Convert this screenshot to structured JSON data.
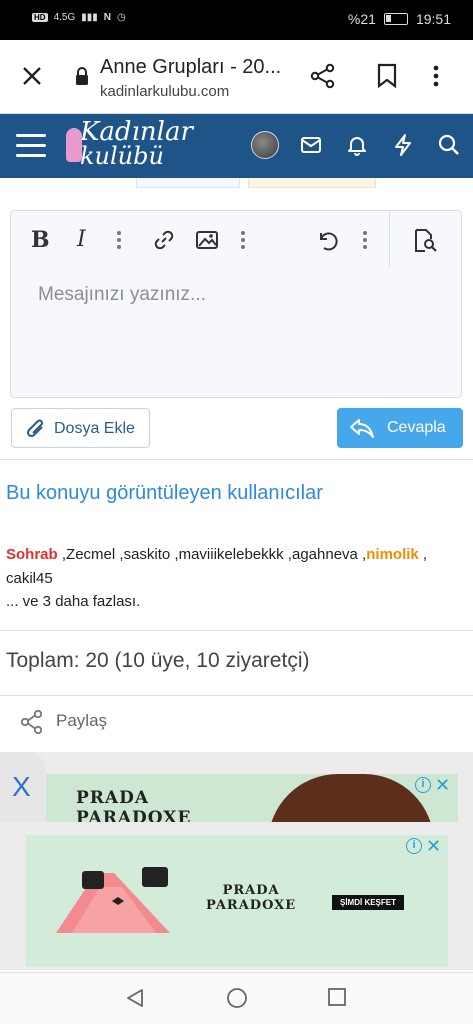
{
  "status_bar": {
    "network": "4.5G",
    "battery": "%21",
    "time": "19:51"
  },
  "browser": {
    "page_title": "Anne Grupları - 20...",
    "url": "kadinlarkulubu.com"
  },
  "site": {
    "logo_line1": "Kadınlar",
    "logo_line2": "kulübü"
  },
  "editor": {
    "placeholder": "Mesajınızı yazınız..."
  },
  "actions": {
    "attach_label": "Dosya Ekle",
    "reply_label": "Cevapla"
  },
  "viewers": {
    "title": "Bu konuyu görüntüleyen kullanıcılar",
    "users": [
      {
        "name": "Sohrab",
        "style": "red"
      },
      {
        "name": "Zecmel",
        "style": "normal"
      },
      {
        "name": "saskito",
        "style": "normal"
      },
      {
        "name": "maviiikelebekkk",
        "style": "normal"
      },
      {
        "name": "agahneva",
        "style": "normal"
      },
      {
        "name": "nimolik",
        "style": "orange"
      },
      {
        "name": "cakil45",
        "style": "normal"
      }
    ],
    "more_text": "... ve 3 daha fazlası.",
    "total_text": "Toplam: 20 (10 üye, 10 ziyaretçi)"
  },
  "share": {
    "label": "Paylaş"
  },
  "ads": {
    "close_tab": "X",
    "brand_line1": "PRADA",
    "brand_line2": "PARADOXE",
    "cta": "ŞİMDİ KEŞFET"
  },
  "colors": {
    "header": "#1f5489",
    "accent": "#2d8ae0",
    "reply_button": "#47a7eb"
  }
}
